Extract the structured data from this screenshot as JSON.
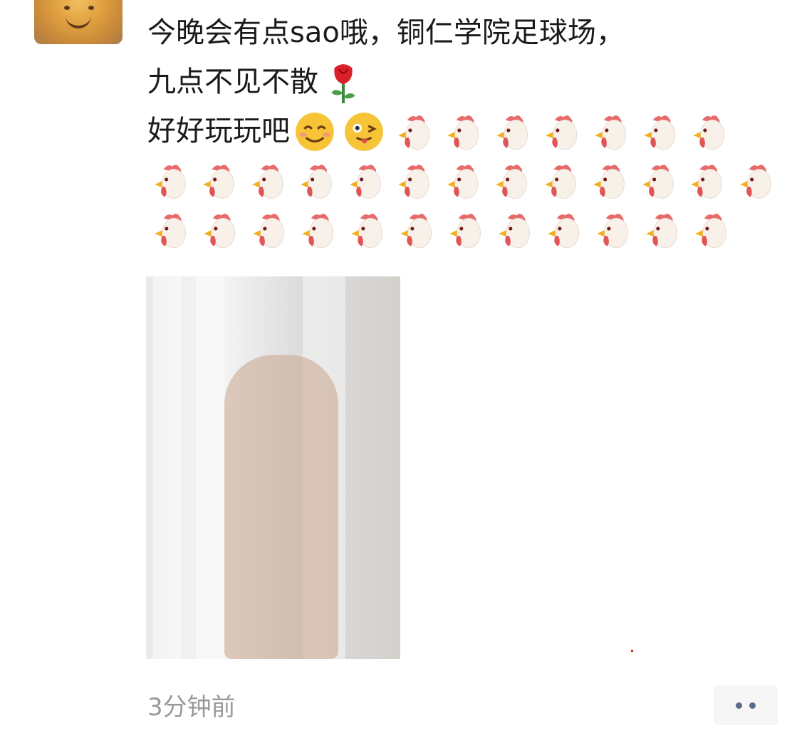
{
  "post": {
    "avatar_icon": "avatar-smiley-icon",
    "lines": [
      {
        "text": "今晚会有点sao哦，铜仁学院足球场，",
        "emojis": []
      },
      {
        "text": "九点不见不散",
        "emojis": [
          "rose"
        ]
      },
      {
        "text": "好好玩玩吧",
        "emojis": [
          "smile-blush",
          "wink-tongue",
          "rooster",
          "rooster",
          "rooster",
          "rooster",
          "rooster",
          "rooster",
          "rooster"
        ]
      },
      {
        "text": "",
        "emojis": [
          "rooster",
          "rooster",
          "rooster",
          "rooster",
          "rooster",
          "rooster",
          "rooster",
          "rooster",
          "rooster",
          "rooster",
          "rooster",
          "rooster",
          "rooster"
        ]
      },
      {
        "text": "",
        "emojis": [
          "rooster",
          "rooster",
          "rooster",
          "rooster",
          "rooster",
          "rooster",
          "rooster",
          "rooster",
          "rooster",
          "rooster",
          "rooster",
          "rooster"
        ]
      }
    ],
    "photo_icon": "photo",
    "timestamp": "3分钟前",
    "more_icon": "more-dots-icon"
  }
}
